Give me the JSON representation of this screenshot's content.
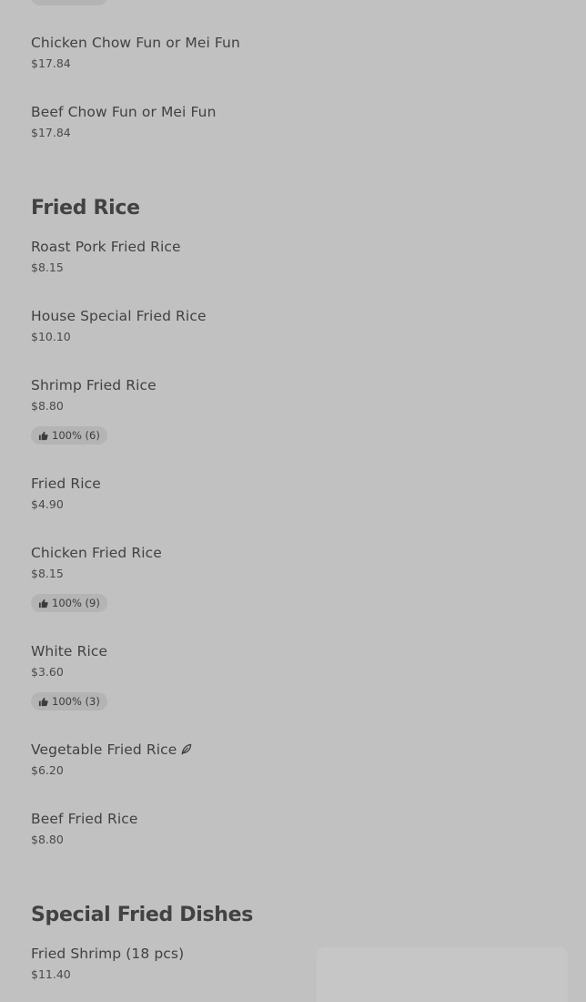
{
  "menu": {
    "top_items": [
      {
        "name": "Chicken Chow Fun or Mei Fun",
        "price": "$17.84"
      },
      {
        "name": "Beef Chow Fun or Mei Fun",
        "price": "$17.84"
      }
    ],
    "fried_rice": {
      "title": "Fried Rice",
      "items": [
        {
          "name": "Roast Pork Fried Rice",
          "price": "$8.15"
        },
        {
          "name": "House Special Fried Rice",
          "price": "$10.10"
        },
        {
          "name": "Shrimp Fried Rice",
          "price": "$8.80",
          "rating": "100% (6)"
        },
        {
          "name": "Fried Rice",
          "price": "$4.90"
        },
        {
          "name": "Chicken Fried Rice",
          "price": "$8.15",
          "rating": "100% (9)"
        },
        {
          "name": "White Rice",
          "price": "$3.60",
          "rating": "100% (3)"
        },
        {
          "name": "Vegetable Fried Rice",
          "price": "$6.20",
          "icon": "leaf-icon"
        },
        {
          "name": "Beef Fried Rice",
          "price": "$8.80"
        }
      ]
    },
    "special_fried": {
      "title": "Special Fried Dishes",
      "items": [
        {
          "name": "Fried Shrimp (18 pcs)",
          "price": "$11.40"
        }
      ]
    }
  },
  "colors": {
    "background": "#c1c1c1",
    "chip": "#b4b4b4",
    "text": "#414141"
  }
}
